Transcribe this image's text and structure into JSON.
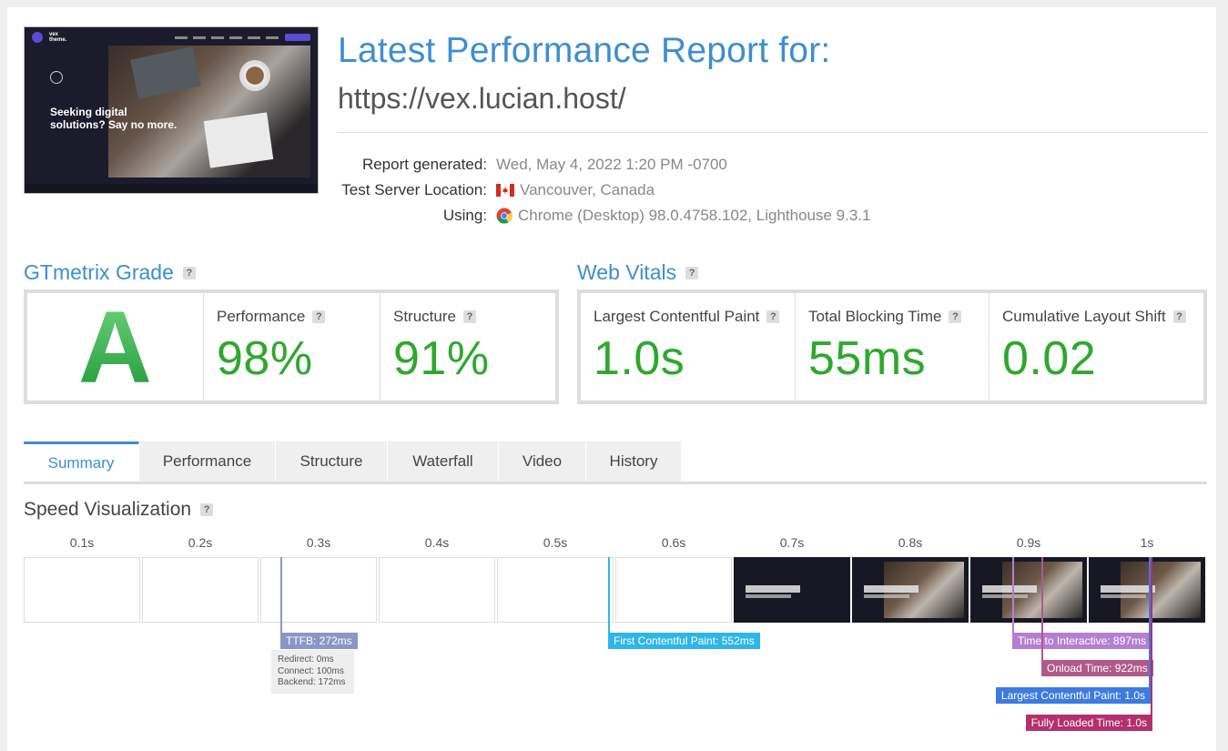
{
  "header": {
    "title": "Latest Performance Report for:",
    "url": "https://vex.lucian.host/",
    "thumbnail": {
      "logo_text_1": "vex",
      "logo_text_2": "theme.",
      "headline_1": "Seeking digital",
      "headline_2": "solutions? Say no more."
    }
  },
  "meta": [
    {
      "label": "Report generated:",
      "value": "Wed, May 4, 2022 1:20 PM -0700",
      "icon": ""
    },
    {
      "label": "Test Server Location:",
      "value": "Vancouver, Canada",
      "icon": "canada-flag-icon"
    },
    {
      "label": "Using:",
      "value": "Chrome (Desktop) 98.0.4758.102, Lighthouse 9.3.1",
      "icon": "chrome-icon"
    }
  ],
  "grade": {
    "title": "GTmetrix Grade",
    "help": "?",
    "letter": "A",
    "performance_label": "Performance",
    "performance_value": "98%",
    "structure_label": "Structure",
    "structure_value": "91%"
  },
  "vitals": {
    "title": "Web Vitals",
    "help": "?",
    "lcp_label": "Largest Contentful Paint",
    "lcp_value": "1.0s",
    "tbt_label": "Total Blocking Time",
    "tbt_value": "55ms",
    "cls_label": "Cumulative Layout Shift",
    "cls_value": "0.02"
  },
  "tabs": [
    "Summary",
    "Performance",
    "Structure",
    "Waterfall",
    "Video",
    "History"
  ],
  "speed": {
    "title": "Speed Visualization",
    "help": "?",
    "ticks": [
      "0.1s",
      "0.2s",
      "0.3s",
      "0.4s",
      "0.5s",
      "0.6s",
      "0.7s",
      "0.8s",
      "0.9s",
      "1s"
    ],
    "frames": [
      "blank",
      "blank",
      "blank",
      "blank",
      "blank",
      "blank",
      "dark",
      "shot",
      "shot",
      "shot"
    ],
    "markers": {
      "ttfb": "TTFB: 272ms",
      "fcp": "First Contentful Paint: 552ms",
      "tti": "Time to Interactive: 897ms",
      "onload": "Onload Time: 922ms",
      "lcp": "Largest Contentful Paint: 1.0s",
      "fully": "Fully Loaded Time: 1.0s"
    },
    "ttfb_detail": {
      "redirect": "Redirect: 0ms",
      "connect": "Connect: 100ms",
      "backend": "Backend: 172ms"
    }
  },
  "colors": {
    "accent": "#3d8ed1",
    "good": "#2ea82e",
    "ttfb": "#8c96c6",
    "fcp": "#2eb6ea",
    "tti": "#b37fd1",
    "onload": "#b05a8a",
    "lcp": "#3d7be0",
    "fully": "#b3306b"
  }
}
